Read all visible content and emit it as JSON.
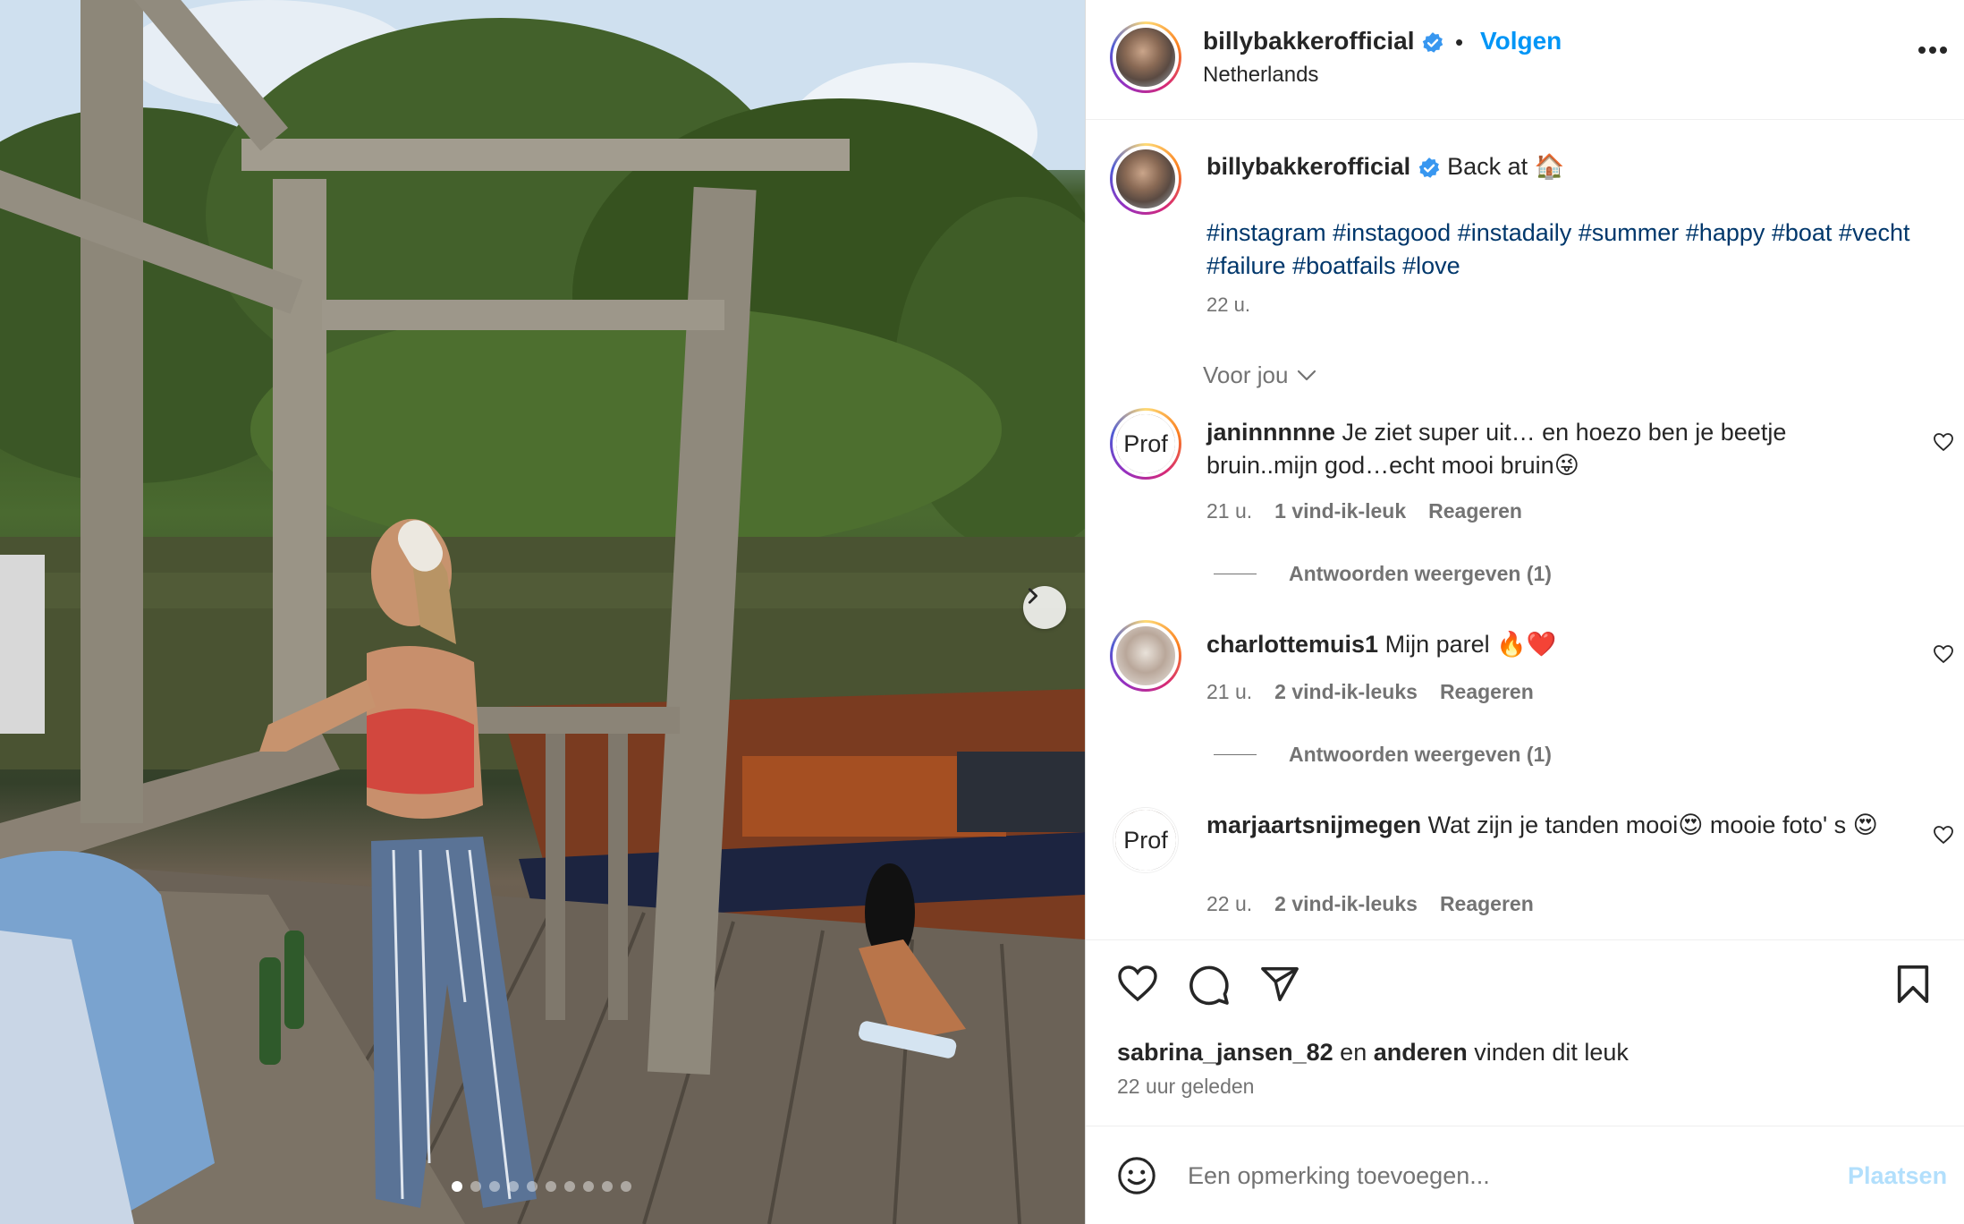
{
  "photo": {
    "alt": "",
    "slide_count": 10,
    "active_slide": 1
  },
  "post_header": {
    "username": "billybakkerofficial",
    "separator": "•",
    "follow_label": "Volgen",
    "location": "Netherlands"
  },
  "caption": {
    "username": "billybakkerofficial",
    "text": "Back at 🏠",
    "hashtags": "#instagram #instagood #instadaily #summer #happy #boat #vecht #failure #boatfails #love",
    "time": "22 u."
  },
  "filter_label": "Voor jou",
  "comments": [
    {
      "username": "janinnnnne",
      "text": "Je ziet super uit… en hoezo ben je beetje bruin..mijn god…echt mooi bruin😜",
      "time": "21 u.",
      "likes": "1 vind-ik-leuk",
      "reply_label": "Reageren",
      "view_replies": "Antwoorden weergeven (1)",
      "avatar_text": "Prof"
    },
    {
      "username": "charlottemuis1",
      "text": "Mijn parel 🔥❤️",
      "time": "21 u.",
      "likes": "2 vind-ik-leuks",
      "reply_label": "Reageren",
      "view_replies": "Antwoorden weergeven (1)"
    },
    {
      "username": "marjaartsnijmegen",
      "text": "Wat zijn je tanden mooi😍 mooie foto' s 😍",
      "time": "22 u.",
      "likes": "2 vind-ik-leuks",
      "reply_label": "Reageren",
      "avatar_text": "Prof"
    }
  ],
  "likes_line": {
    "user": "sabrina_jansen_82",
    "connector": "en",
    "others": "anderen",
    "suffix": "vinden dit leuk"
  },
  "posted_ago": "22 uur geleden",
  "comment_input": {
    "placeholder": "Een opmerking toevoegen...",
    "post_label": "Plaatsen"
  },
  "colors": {
    "link_blue": "#0095f6",
    "hashtag_blue": "#00376b",
    "muted": "#737373",
    "post_disabled": "#b2dffc"
  }
}
